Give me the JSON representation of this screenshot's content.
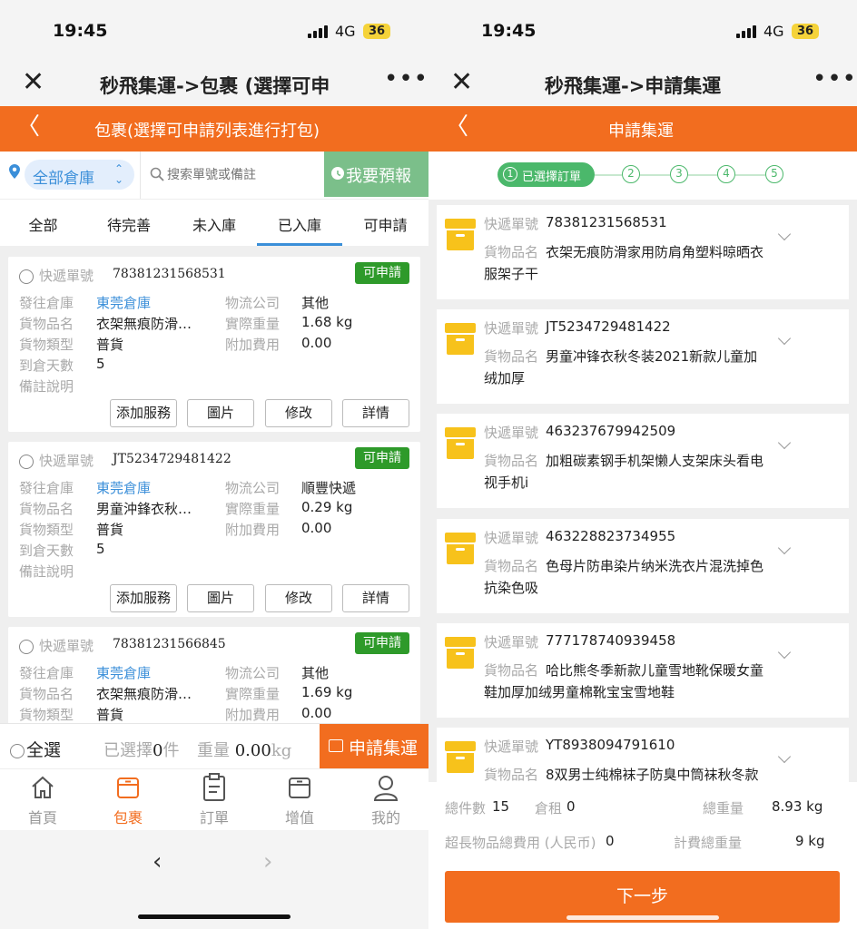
{
  "colors": {
    "accent": "#f26d1f",
    "green": "#2e9a2a",
    "step_green": "#4bb86b",
    "link_blue": "#3b8fd9",
    "box_yellow": "#f7c21b"
  },
  "status": {
    "time": "19:45",
    "network": "4G",
    "battery": "36"
  },
  "left": {
    "title": "秒飛集運->包裹 (選擇可申",
    "header": "包裹(選擇可申請列表進行打包)",
    "warehouse_select": "全部倉庫",
    "search_placeholder": "搜索單號或備註",
    "reserve_label": "我要預報",
    "tabs": [
      "全部",
      "待完善",
      "未入庫",
      "已入庫",
      "可申請"
    ],
    "active_tab": "已入庫",
    "field_labels": {
      "tracking": "快遞單號",
      "warehouse": "發往倉庫",
      "item": "貨物品名",
      "type": "貨物類型",
      "days": "到倉天數",
      "remark": "備註說明",
      "carrier": "物流公司",
      "weight": "實際重量",
      "fee": "附加費用"
    },
    "cards": [
      {
        "tracking_no": "78381231568531",
        "status": "可申請",
        "warehouse": "東莞倉庫",
        "item": "衣架無痕防滑…",
        "type": "普貨",
        "days": "5",
        "carrier": "其他",
        "weight": "1.68 kg",
        "fee": "0.00"
      },
      {
        "tracking_no": "JT5234729481422",
        "status": "可申請",
        "warehouse": "東莞倉庫",
        "item": "男童沖鋒衣秋…",
        "type": "普貨",
        "days": "5",
        "carrier": "順豐快遞",
        "weight": "0.29 kg",
        "fee": "0.00"
      },
      {
        "tracking_no": "78381231566845",
        "status": "可申請",
        "warehouse": "東莞倉庫",
        "item": "衣架無痕防滑…",
        "type": "普貨",
        "days": "",
        "carrier": "其他",
        "weight": "1.69 kg",
        "fee": "0.00"
      }
    ],
    "card_buttons": [
      "添加服務",
      "圖片",
      "修改",
      "詳情"
    ],
    "footer": {
      "select_all": "全選",
      "selected_prefix": "已選擇",
      "selected_count": "0",
      "selected_unit": "件",
      "weight_label": "重量",
      "weight_value": "0.00",
      "weight_unit": "kg",
      "apply_button": "申請集運"
    },
    "nav": [
      "首頁",
      "包裹",
      "訂單",
      "增值",
      "我的"
    ],
    "active_nav": "包裹"
  },
  "right": {
    "title": "秒飛集運->申請集運",
    "header": "申請集運",
    "steps": [
      "1",
      "2",
      "3",
      "4",
      "5"
    ],
    "active_step_label": "已選擇訂單",
    "tracking_label": "快遞單號",
    "item_label": "貨物品名",
    "items": [
      {
        "tracking_no": "78381231568531",
        "name_line1": "衣架无痕防滑家用防肩角塑料晾晒衣",
        "name_line2": "服架子干"
      },
      {
        "tracking_no": "JT5234729481422",
        "name_line1": "男童冲锋衣秋冬装2021新款儿童加",
        "name_line2": "绒加厚"
      },
      {
        "tracking_no": "463237679942509",
        "name_line1": "加粗碳素钢手机架懒人支架床头看电",
        "name_line2": "视手机i"
      },
      {
        "tracking_no": "463228823734955",
        "name_line1": "色母片防串染片纳米洗衣片混洗掉色",
        "name_line2": "抗染色吸"
      },
      {
        "tracking_no": "777178740939458",
        "name_line1": "哈比熊冬季新款儿童雪地靴保暖女童",
        "name_line2": "鞋加厚加绒男童棉靴宝宝雪地鞋"
      },
      {
        "tracking_no": "YT8938094791610",
        "name_line1": "8双男士纯棉袜子防臭中筒袜秋冬款",
        "name_line2": ""
      }
    ],
    "summary": {
      "total_label": "總件數",
      "total_value": "15",
      "rent_label": "倉租",
      "rent_value": "0",
      "weight_label": "總重量",
      "weight_value": "8.93 kg",
      "oversize_label": "超長物品總費用 (人民币)",
      "oversize_value": "0",
      "billed_label": "計費總重量",
      "billed_value": "9 kg"
    },
    "next_button": "下一步"
  }
}
